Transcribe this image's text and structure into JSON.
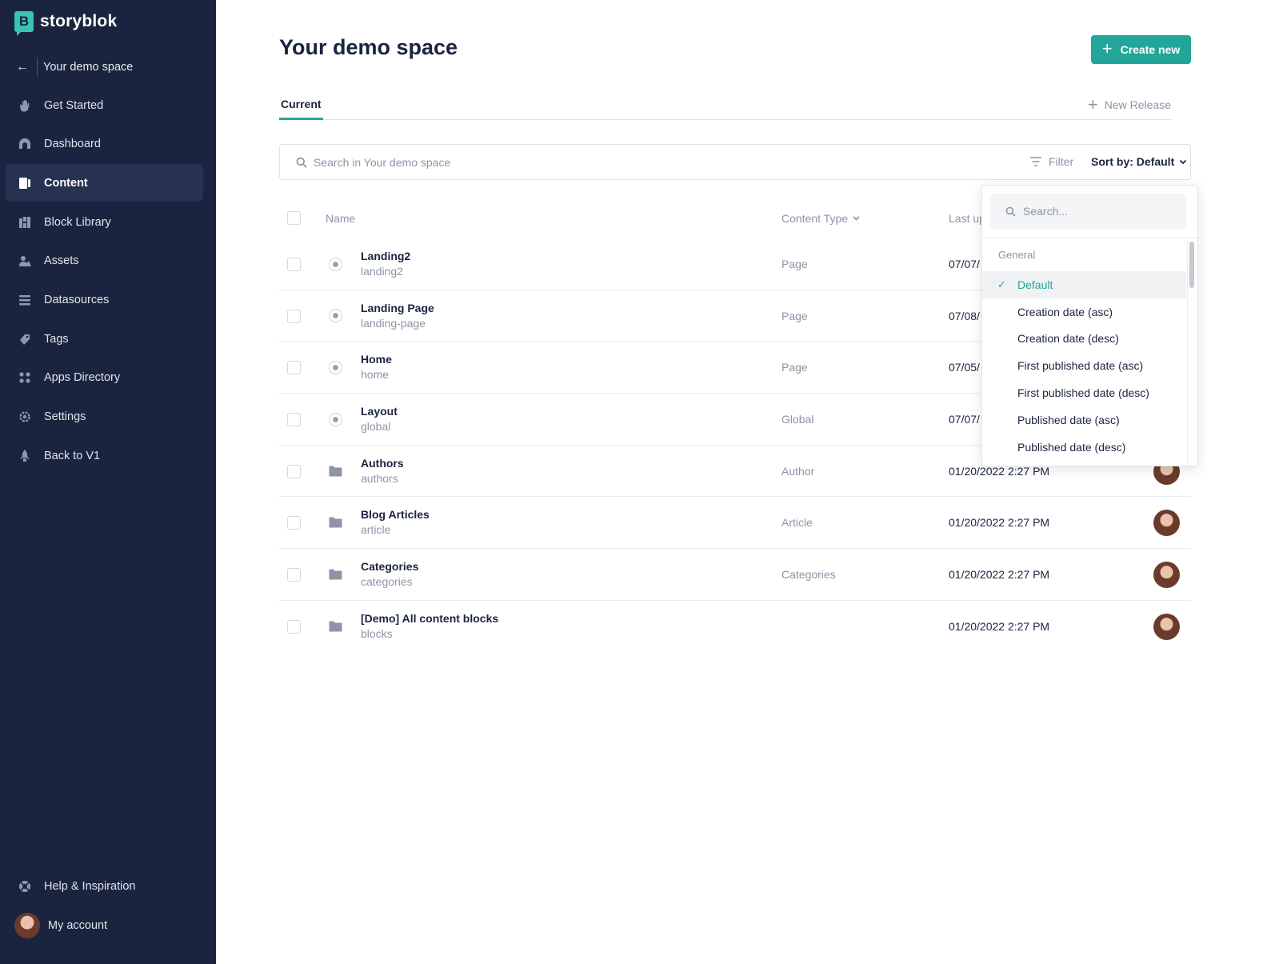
{
  "brand": {
    "name": "storyblok",
    "logo_letter": "B"
  },
  "sidebar": {
    "back_label": "Your demo space",
    "items": [
      {
        "label": "Get Started",
        "icon": "hand-wave-icon"
      },
      {
        "label": "Dashboard",
        "icon": "dashboard-gauge-icon"
      },
      {
        "label": "Content",
        "icon": "content-icon",
        "active": true
      },
      {
        "label": "Block Library",
        "icon": "block-library-icon"
      },
      {
        "label": "Assets",
        "icon": "assets-icon"
      },
      {
        "label": "Datasources",
        "icon": "datasources-icon"
      },
      {
        "label": "Tags",
        "icon": "tag-icon"
      },
      {
        "label": "Apps Directory",
        "icon": "apps-grid-icon"
      },
      {
        "label": "Settings",
        "icon": "gear-icon"
      },
      {
        "label": "Back to V1",
        "icon": "rocket-icon"
      }
    ],
    "help_label": "Help & Inspiration",
    "account_label": "My account"
  },
  "header": {
    "title": "Your demo space",
    "create_label": "Create new"
  },
  "tabs": {
    "current": "Current",
    "new_release": "New Release"
  },
  "search": {
    "placeholder": "Search in Your demo space",
    "filter_label": "Filter",
    "sort_label": "Sort by: Default"
  },
  "table": {
    "headers": {
      "name": "Name",
      "content_type": "Content Type",
      "last_updated": "Last up"
    },
    "rows": [
      {
        "name": "Landing2",
        "slug": "landing2",
        "type": "Page",
        "date": "07/07/",
        "kind": "story"
      },
      {
        "name": "Landing Page",
        "slug": "landing-page",
        "type": "Page",
        "date": "07/08/",
        "kind": "story"
      },
      {
        "name": "Home",
        "slug": "home",
        "type": "Page",
        "date": "07/05/",
        "kind": "story"
      },
      {
        "name": "Layout",
        "slug": "global",
        "type": "Global",
        "date": "07/07/",
        "kind": "story"
      },
      {
        "name": "Authors",
        "slug": "authors",
        "type": "Author",
        "date": "01/20/2022 2:27 PM",
        "kind": "folder"
      },
      {
        "name": "Blog Articles",
        "slug": "article",
        "type": "Article",
        "date": "01/20/2022 2:27 PM",
        "kind": "folder"
      },
      {
        "name": "Categories",
        "slug": "categories",
        "type": "Categories",
        "date": "01/20/2022 2:27 PM",
        "kind": "folder"
      },
      {
        "name": "[Demo] All content blocks",
        "slug": "blocks",
        "type": "",
        "date": "01/20/2022 2:27 PM",
        "kind": "folder"
      }
    ]
  },
  "sort_dropdown": {
    "search_placeholder": "Search...",
    "group_label": "General",
    "options": [
      {
        "label": "Default",
        "selected": true
      },
      {
        "label": "Creation date (asc)"
      },
      {
        "label": "Creation date (desc)"
      },
      {
        "label": "First published date (asc)"
      },
      {
        "label": "First published date (desc)"
      },
      {
        "label": "Published date (asc)"
      },
      {
        "label": "Published date (desc)"
      }
    ]
  },
  "colors": {
    "sidebar_bg": "#1b243f",
    "accent": "#23a69a",
    "brand_teal": "#3ac2b4",
    "muted_text": "#8d94a6"
  }
}
